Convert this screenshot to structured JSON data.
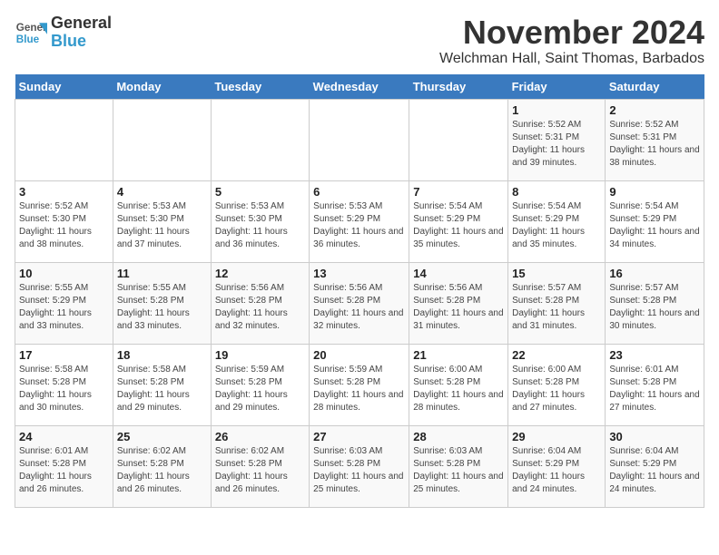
{
  "logo": {
    "line1": "General",
    "line2": "Blue"
  },
  "title": "November 2024",
  "location": "Welchman Hall, Saint Thomas, Barbados",
  "days_of_week": [
    "Sunday",
    "Monday",
    "Tuesday",
    "Wednesday",
    "Thursday",
    "Friday",
    "Saturday"
  ],
  "weeks": [
    [
      {
        "day": "",
        "info": ""
      },
      {
        "day": "",
        "info": ""
      },
      {
        "day": "",
        "info": ""
      },
      {
        "day": "",
        "info": ""
      },
      {
        "day": "",
        "info": ""
      },
      {
        "day": "1",
        "info": "Sunrise: 5:52 AM\nSunset: 5:31 PM\nDaylight: 11 hours and 39 minutes."
      },
      {
        "day": "2",
        "info": "Sunrise: 5:52 AM\nSunset: 5:31 PM\nDaylight: 11 hours and 38 minutes."
      }
    ],
    [
      {
        "day": "3",
        "info": "Sunrise: 5:52 AM\nSunset: 5:30 PM\nDaylight: 11 hours and 38 minutes."
      },
      {
        "day": "4",
        "info": "Sunrise: 5:53 AM\nSunset: 5:30 PM\nDaylight: 11 hours and 37 minutes."
      },
      {
        "day": "5",
        "info": "Sunrise: 5:53 AM\nSunset: 5:30 PM\nDaylight: 11 hours and 36 minutes."
      },
      {
        "day": "6",
        "info": "Sunrise: 5:53 AM\nSunset: 5:29 PM\nDaylight: 11 hours and 36 minutes."
      },
      {
        "day": "7",
        "info": "Sunrise: 5:54 AM\nSunset: 5:29 PM\nDaylight: 11 hours and 35 minutes."
      },
      {
        "day": "8",
        "info": "Sunrise: 5:54 AM\nSunset: 5:29 PM\nDaylight: 11 hours and 35 minutes."
      },
      {
        "day": "9",
        "info": "Sunrise: 5:54 AM\nSunset: 5:29 PM\nDaylight: 11 hours and 34 minutes."
      }
    ],
    [
      {
        "day": "10",
        "info": "Sunrise: 5:55 AM\nSunset: 5:29 PM\nDaylight: 11 hours and 33 minutes."
      },
      {
        "day": "11",
        "info": "Sunrise: 5:55 AM\nSunset: 5:28 PM\nDaylight: 11 hours and 33 minutes."
      },
      {
        "day": "12",
        "info": "Sunrise: 5:56 AM\nSunset: 5:28 PM\nDaylight: 11 hours and 32 minutes."
      },
      {
        "day": "13",
        "info": "Sunrise: 5:56 AM\nSunset: 5:28 PM\nDaylight: 11 hours and 32 minutes."
      },
      {
        "day": "14",
        "info": "Sunrise: 5:56 AM\nSunset: 5:28 PM\nDaylight: 11 hours and 31 minutes."
      },
      {
        "day": "15",
        "info": "Sunrise: 5:57 AM\nSunset: 5:28 PM\nDaylight: 11 hours and 31 minutes."
      },
      {
        "day": "16",
        "info": "Sunrise: 5:57 AM\nSunset: 5:28 PM\nDaylight: 11 hours and 30 minutes."
      }
    ],
    [
      {
        "day": "17",
        "info": "Sunrise: 5:58 AM\nSunset: 5:28 PM\nDaylight: 11 hours and 30 minutes."
      },
      {
        "day": "18",
        "info": "Sunrise: 5:58 AM\nSunset: 5:28 PM\nDaylight: 11 hours and 29 minutes."
      },
      {
        "day": "19",
        "info": "Sunrise: 5:59 AM\nSunset: 5:28 PM\nDaylight: 11 hours and 29 minutes."
      },
      {
        "day": "20",
        "info": "Sunrise: 5:59 AM\nSunset: 5:28 PM\nDaylight: 11 hours and 28 minutes."
      },
      {
        "day": "21",
        "info": "Sunrise: 6:00 AM\nSunset: 5:28 PM\nDaylight: 11 hours and 28 minutes."
      },
      {
        "day": "22",
        "info": "Sunrise: 6:00 AM\nSunset: 5:28 PM\nDaylight: 11 hours and 27 minutes."
      },
      {
        "day": "23",
        "info": "Sunrise: 6:01 AM\nSunset: 5:28 PM\nDaylight: 11 hours and 27 minutes."
      }
    ],
    [
      {
        "day": "24",
        "info": "Sunrise: 6:01 AM\nSunset: 5:28 PM\nDaylight: 11 hours and 26 minutes."
      },
      {
        "day": "25",
        "info": "Sunrise: 6:02 AM\nSunset: 5:28 PM\nDaylight: 11 hours and 26 minutes."
      },
      {
        "day": "26",
        "info": "Sunrise: 6:02 AM\nSunset: 5:28 PM\nDaylight: 11 hours and 26 minutes."
      },
      {
        "day": "27",
        "info": "Sunrise: 6:03 AM\nSunset: 5:28 PM\nDaylight: 11 hours and 25 minutes."
      },
      {
        "day": "28",
        "info": "Sunrise: 6:03 AM\nSunset: 5:28 PM\nDaylight: 11 hours and 25 minutes."
      },
      {
        "day": "29",
        "info": "Sunrise: 6:04 AM\nSunset: 5:29 PM\nDaylight: 11 hours and 24 minutes."
      },
      {
        "day": "30",
        "info": "Sunrise: 6:04 AM\nSunset: 5:29 PM\nDaylight: 11 hours and 24 minutes."
      }
    ]
  ]
}
